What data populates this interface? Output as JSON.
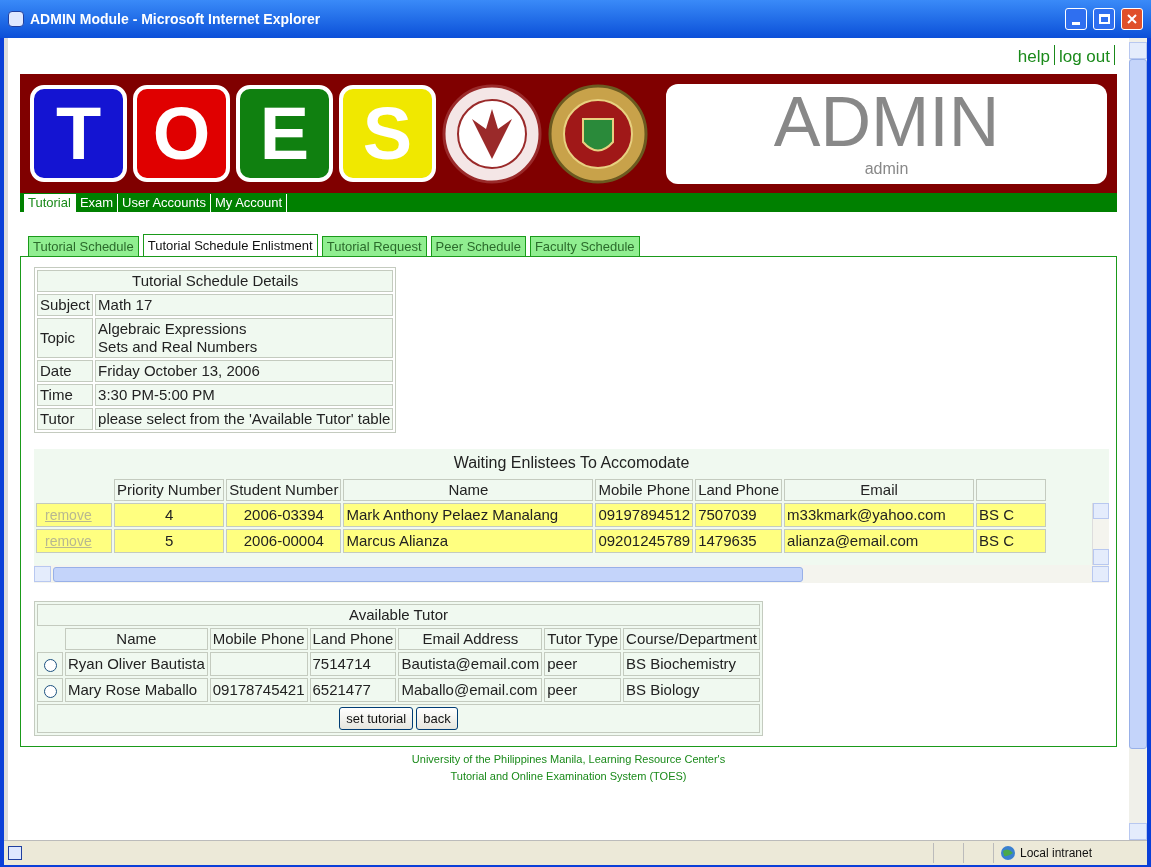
{
  "window": {
    "title": "ADMIN Module - Microsoft Internet Explorer"
  },
  "top_links": [
    "help",
    "log out"
  ],
  "logo_letters": [
    {
      "letter": "T",
      "color": "#1414d2"
    },
    {
      "letter": "O",
      "color": "#e00000"
    },
    {
      "letter": "E",
      "color": "#108010"
    },
    {
      "letter": "S",
      "color": "#f0e800"
    }
  ],
  "banner": {
    "title": "ADMIN",
    "subtitle": "admin"
  },
  "main_tabs": [
    {
      "label": "Tutorial",
      "selected": true
    },
    {
      "label": "Exam",
      "selected": false
    },
    {
      "label": "User Accounts",
      "selected": false
    },
    {
      "label": "My Account",
      "selected": false
    }
  ],
  "sub_tabs": [
    {
      "label": "Tutorial Schedule",
      "selected": false
    },
    {
      "label": "Tutorial Schedule Enlistment",
      "selected": true
    },
    {
      "label": "Tutorial Request",
      "selected": false
    },
    {
      "label": "Peer Schedule",
      "selected": false
    },
    {
      "label": "Faculty Schedule",
      "selected": false
    }
  ],
  "details": {
    "title": "Tutorial Schedule Details",
    "rows": [
      {
        "label": "Subject",
        "lines": [
          "Math 17"
        ]
      },
      {
        "label": "Topic",
        "lines": [
          "Algebraic Expressions",
          "Sets and Real Numbers"
        ]
      },
      {
        "label": "Date",
        "lines": [
          "Friday October 13, 2006"
        ]
      },
      {
        "label": "Time",
        "lines": [
          "3:30 PM-5:00 PM"
        ]
      },
      {
        "label": "Tutor",
        "lines": [
          "please select from the 'Available Tutor' table"
        ]
      }
    ]
  },
  "waiting": {
    "title": "Waiting Enlistees To Accomodate",
    "columns": [
      "Priority Number",
      "Student Number",
      "Name",
      "Mobile Phone",
      "Land Phone",
      "Email"
    ],
    "rows": [
      {
        "action": "remove",
        "cells": [
          "4",
          "2006-03394",
          "Mark Anthony Pelaez Manalang",
          "09197894512",
          "7507039",
          "m33kmark@yahoo.com",
          "BS C"
        ]
      },
      {
        "action": "remove",
        "cells": [
          "5",
          "2006-00004",
          "Marcus Alianza",
          "09201245789",
          "1479635",
          "alianza@email.com",
          "BS C"
        ]
      }
    ]
  },
  "tutors": {
    "title": "Available Tutor",
    "columns": [
      "Name",
      "Mobile Phone",
      "Land Phone",
      "Email Address",
      "Tutor Type",
      "Course/Department"
    ],
    "rows": [
      {
        "selected": false,
        "cells": [
          "Ryan Oliver Bautista",
          "",
          "7514714",
          "Bautista@email.com",
          "peer",
          "BS Biochemistry"
        ]
      },
      {
        "selected": false,
        "cells": [
          "Mary Rose Maballo",
          "09178745421",
          "6521477",
          "Maballo@email.com",
          "peer",
          "BS Biology"
        ]
      }
    ],
    "buttons": [
      "set tutorial",
      "back"
    ]
  },
  "footer": [
    "University of the Philippines Manila, Learning Resource Center's",
    "Tutorial and Online Examination System (TOES)"
  ],
  "status_bar": {
    "zone": "Local intranet"
  }
}
